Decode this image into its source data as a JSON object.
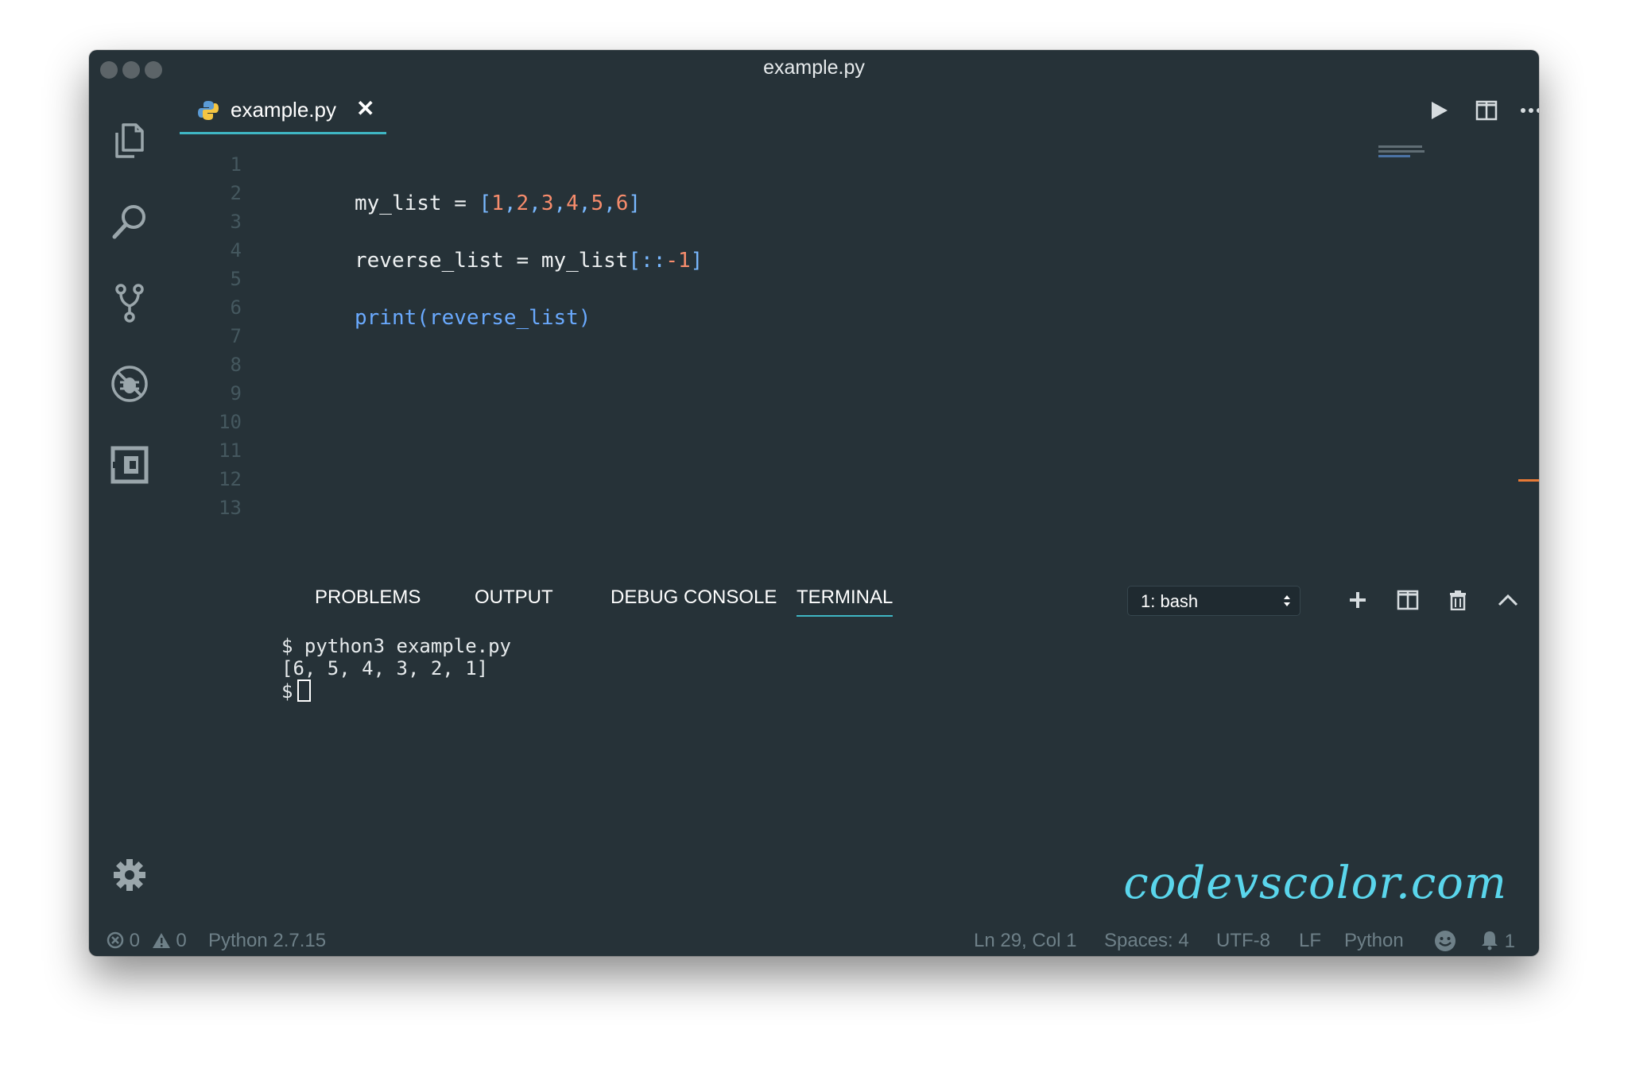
{
  "window": {
    "title": "example.py"
  },
  "tab": {
    "label": "example.py",
    "close": "✕"
  },
  "editor": {
    "line_numbers": [
      "1",
      "2",
      "3",
      "4",
      "5",
      "6",
      "7",
      "8",
      "9",
      "10",
      "11",
      "12",
      "13"
    ],
    "code": {
      "line1_var": "my_list",
      "line1_eq": " = ",
      "line1_open": "[",
      "line1_nums": [
        "1",
        "2",
        "3",
        "4",
        "5",
        "6"
      ],
      "line1_comma": ",",
      "line1_close": "]",
      "line3_var": "reverse_list",
      "line3_eq": " = ",
      "line3_src": "my_list",
      "line3_slice_open": "[::",
      "line3_minus": "-1",
      "line3_slice_close": "]",
      "line5_fn": "print",
      "line5_args": "(reverse_list)"
    }
  },
  "panel": {
    "tabs": [
      "PROBLEMS",
      "OUTPUT",
      "DEBUG CONSOLE",
      "TERMINAL"
    ],
    "active_tab": "TERMINAL",
    "terminal_selector": "1: bash",
    "terminal_lines": [
      "$ python3 example.py",
      "[6, 5, 4, 3, 2, 1]",
      "$"
    ]
  },
  "watermark": "codevscolor.com",
  "statusbar": {
    "errors": "0",
    "warnings": "0",
    "interpreter": "Python 2.7.15",
    "position": "Ln 29, Col 1",
    "spaces": "Spaces: 4",
    "encoding": "UTF-8",
    "eol": "LF",
    "language": "Python",
    "notifications": "1"
  },
  "colors": {
    "background": "#263238",
    "accent": "#3fb6c4",
    "number": "#f78c6c",
    "punctuation": "#79b8ff",
    "function": "#6aaaff",
    "watermark": "#5ad6ec"
  },
  "icons": {
    "activity": [
      "files-icon",
      "search-icon",
      "source-control-icon",
      "debug-icon",
      "extensions-icon"
    ],
    "editor_actions": [
      "run-icon",
      "split-editor-icon",
      "more-icon"
    ],
    "panel_actions": [
      "new-terminal-icon",
      "split-terminal-icon",
      "trash-icon",
      "maximize-icon",
      "toggle-panel-icon",
      "close-icon"
    ]
  }
}
